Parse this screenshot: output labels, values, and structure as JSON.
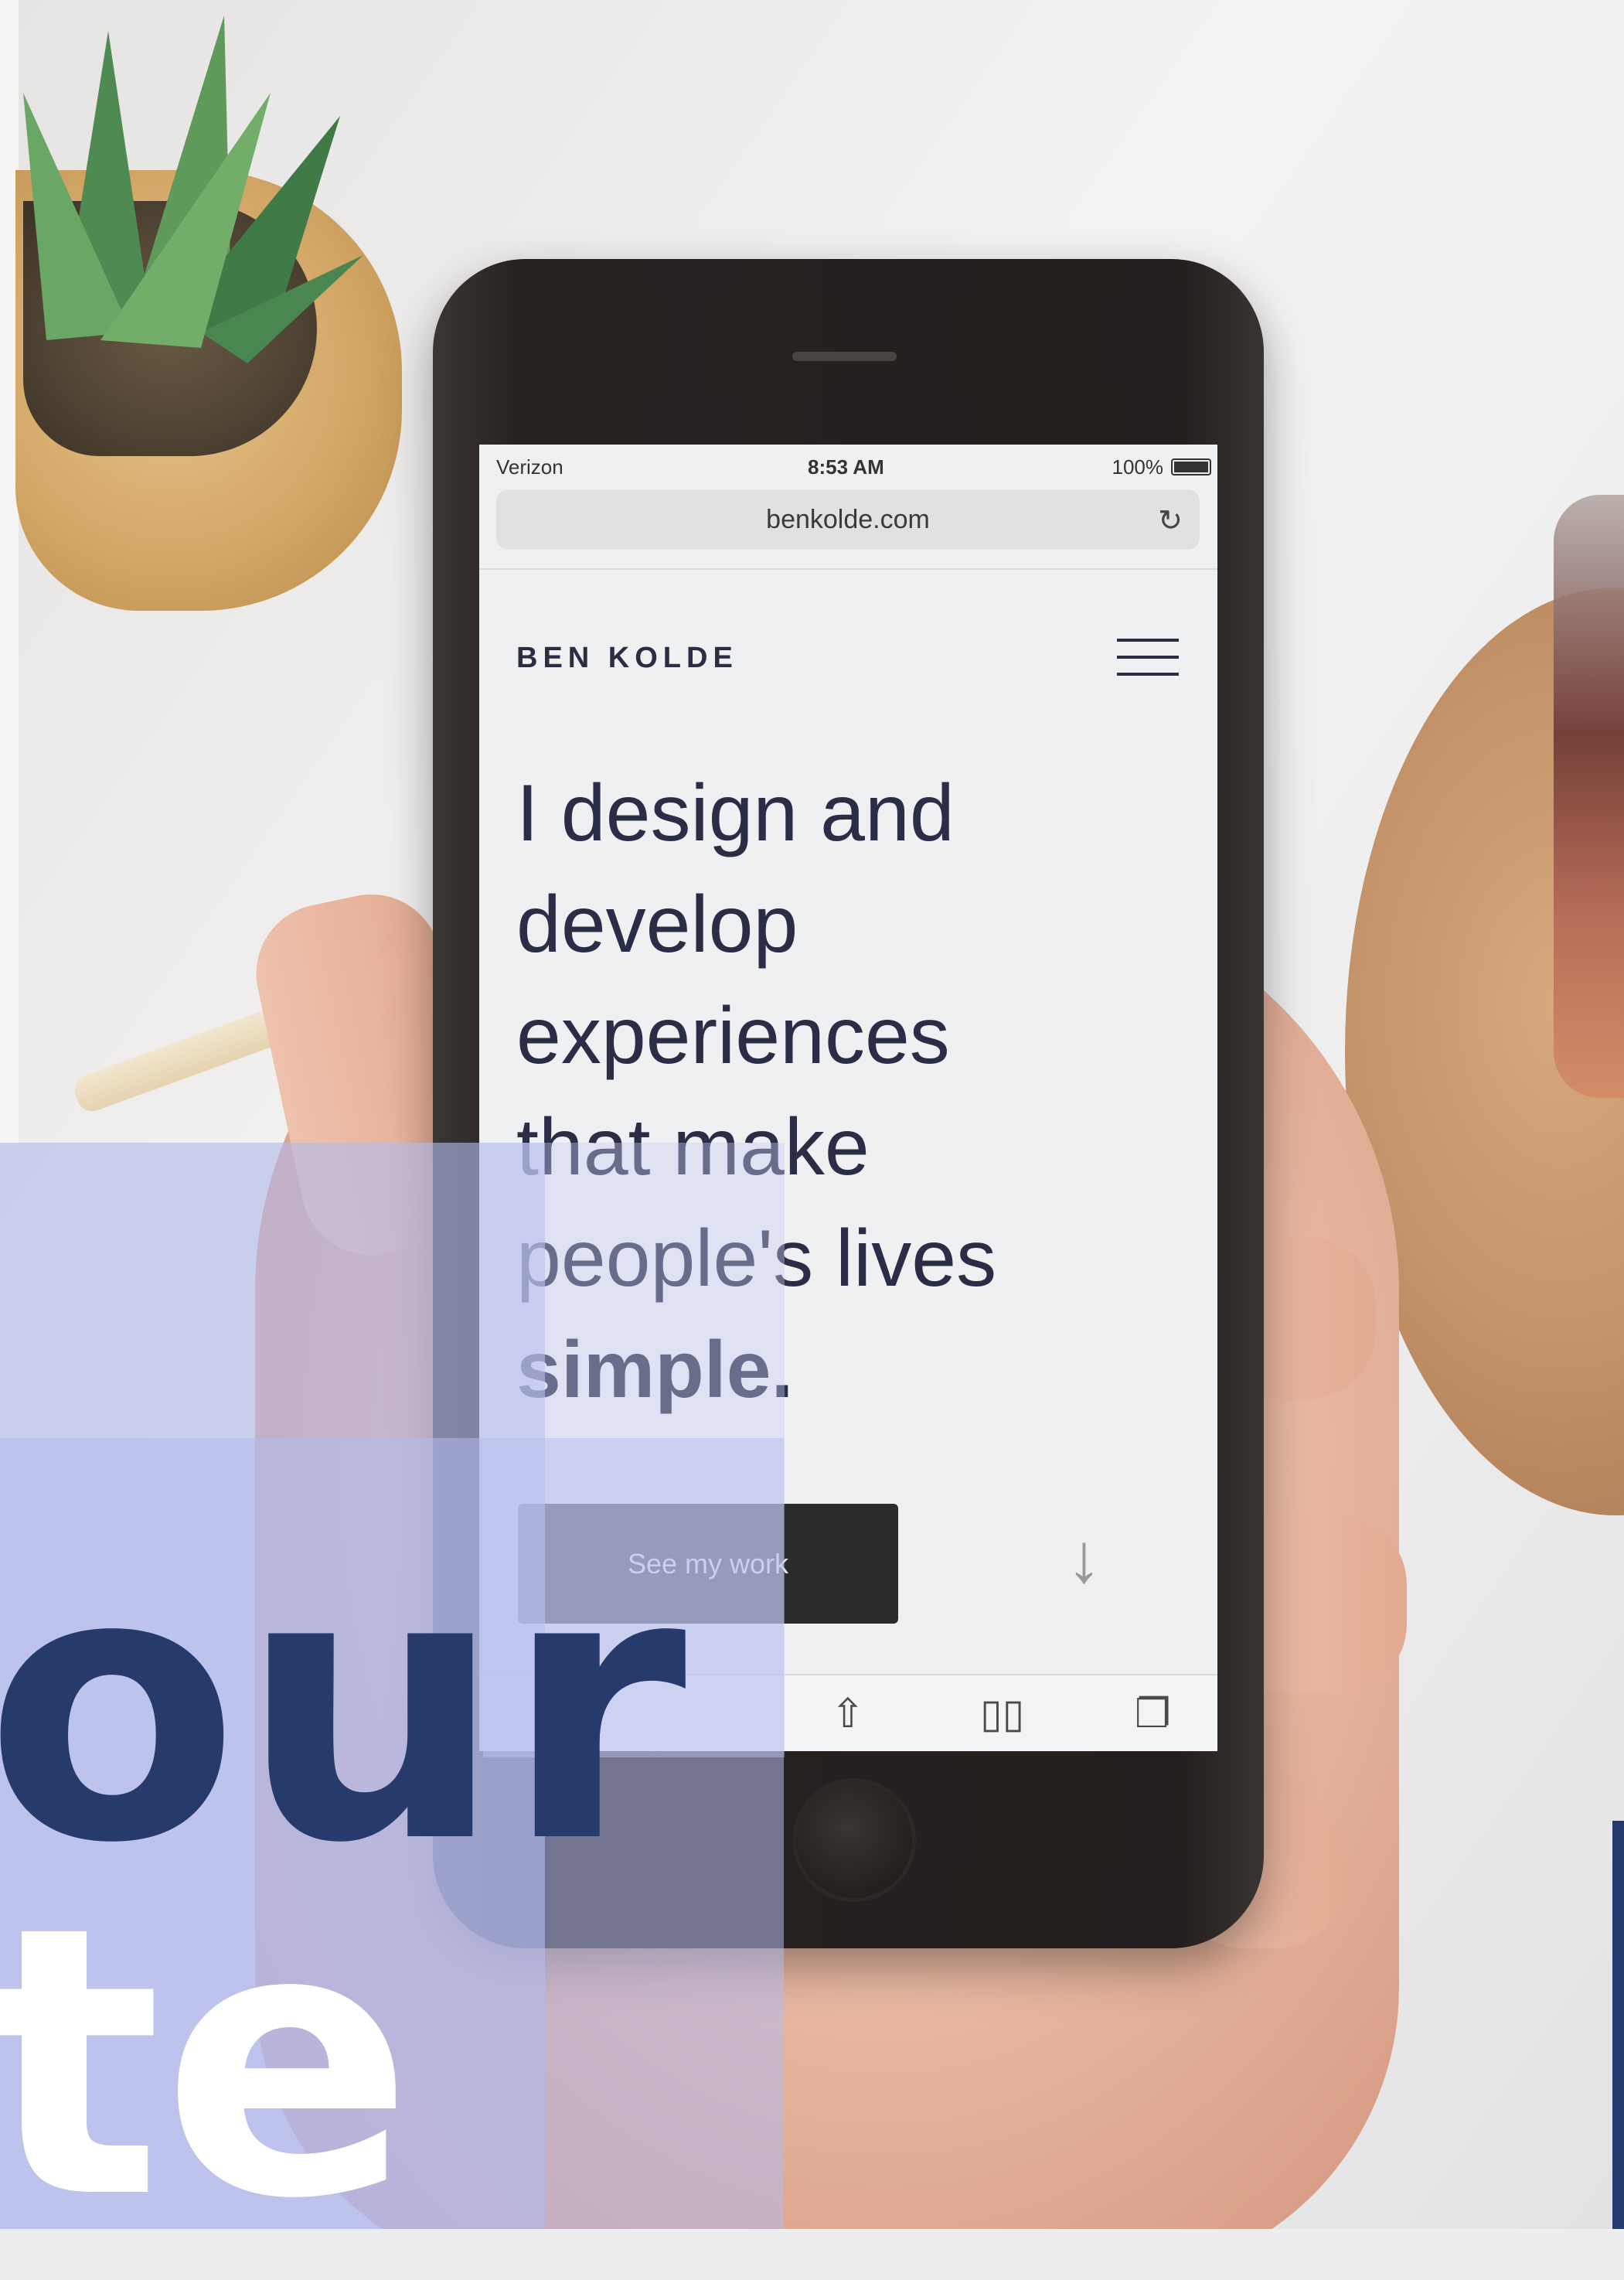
{
  "photo": {
    "description_tags": [
      "hand-holding-phone",
      "succulent-pot",
      "cork-coaster",
      "glass"
    ]
  },
  "phone": {
    "status_bar": {
      "carrier": "Verizon",
      "time": "8:53 AM",
      "battery": "100%"
    },
    "browser": {
      "url": "benkolde.com",
      "reload_icon": "↻"
    },
    "site": {
      "brand": "BEN KOLDE",
      "hero_lines": [
        "I design and",
        "develop",
        "experiences",
        "that make",
        "people's lives"
      ],
      "hero_bold": "simple.",
      "cta_label": "See my work",
      "scroll_arrow": "↓"
    },
    "toolbar_icons": {
      "share": "⇧",
      "bookmarks": "▯▯",
      "tabs": "❐"
    }
  },
  "overlay": {
    "headline_line1": "our",
    "headline_line2": "te",
    "colors": {
      "navy": "#263a6b",
      "lavender": "#b2baec",
      "white": "#ffffff"
    }
  }
}
